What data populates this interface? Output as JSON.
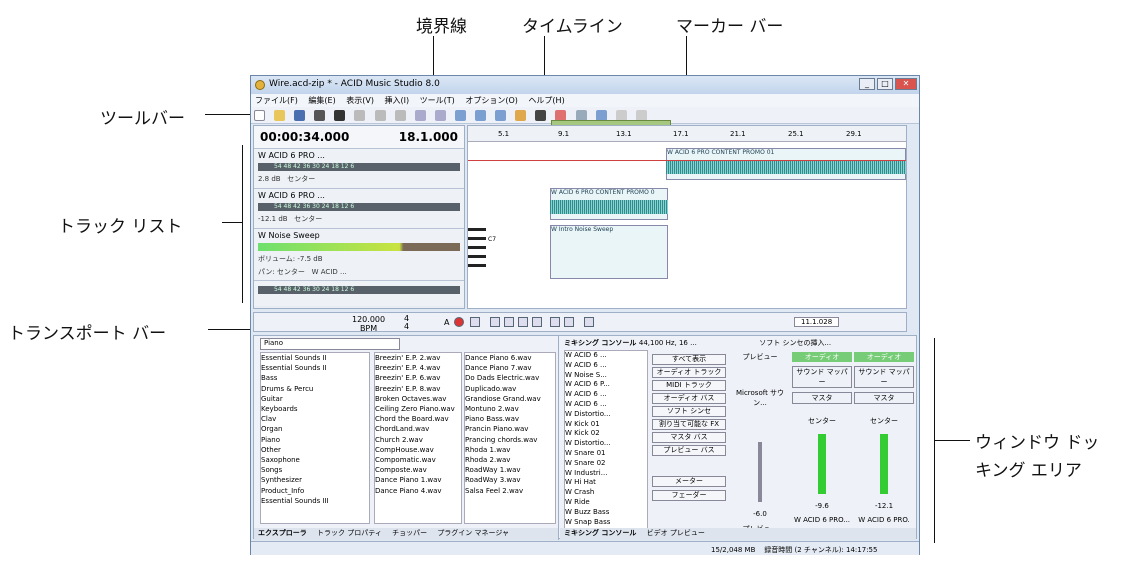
{
  "callouts": {
    "boundary": "境界線",
    "timeline": "タイムライン",
    "marker_bar": "マーカー バー",
    "toolbar": "ツールバー",
    "track_list": "トラック リスト",
    "transport_bar": "トランスポート バー",
    "docking_area_1": "ウィンドウ ドッ",
    "docking_area_2": "キング エリア"
  },
  "window": {
    "title": "Wire.acd-zip * - ACID Music Studio 8.0"
  },
  "menu": [
    "ファイル(F)",
    "編集(E)",
    "表示(V)",
    "挿入(I)",
    "ツール(T)",
    "オプション(O)",
    "ヘルプ(H)"
  ],
  "time": {
    "position": "00:00:34.000",
    "beat": "18.1.000"
  },
  "tracks": [
    {
      "name": "W ACID 6 PRO ...",
      "out": "アウト",
      "db": "2.8 dB",
      "pan": "センター",
      "meter": "54 48 42 36 30 24 18 12 6"
    },
    {
      "name": "W ACID 6 PRO ...",
      "out": "アウト",
      "db": "-12.1 dB",
      "pan": "センター",
      "meter": "54 48 42 36 30 24 18 12 6"
    },
    {
      "name": "W Noise Sweep",
      "out": "アウト",
      "db": "ボリューム: -7.5 dB",
      "pan": "パン: センター",
      "bus": "W ACID ..."
    },
    {
      "name": "",
      "out": "アウト",
      "db": "",
      "pan": "",
      "meter": "54 48 42 36 30 24 18 12 6"
    }
  ],
  "ruler": [
    "5.1",
    "9.1",
    "13.1",
    "17.1",
    "21.1",
    "25.1",
    "29.1"
  ],
  "clips": {
    "a": "W ACID 6 PRO CONTENT PROMO 01",
    "b": "W ACID 6 PRO CONTENT PROMO 0",
    "c": "W Intro Noise Sweep",
    "note": "C7"
  },
  "transport": {
    "tempo": "120.000",
    "bpm": "BPM",
    "sig_top": "4",
    "sig_bottom": "4",
    "key": "A",
    "position": "11.1.028"
  },
  "explorer": {
    "path": "Piano",
    "tree": [
      "Essential Sounds II",
      "Essential Sounds II",
      "Bass",
      "Drums & Percu",
      "Guitar",
      "Keyboards",
      "Clav",
      "Organ",
      "Piano",
      "Other",
      "Saxophone",
      "Songs",
      "Synthesizer",
      "Product_Info",
      "Essential Sounds III"
    ],
    "files1": [
      "Breezin' E.P. 2.wav",
      "Breezin' E.P. 4.wav",
      "Breezin' E.P. 6.wav",
      "Breezin' E.P. 8.wav",
      "Broken Octaves.wav",
      "Ceiling Zero Piano.wav",
      "Chord the Board.wav",
      "ChordLand.wav",
      "Church 2.wav",
      "CompHouse.wav",
      "Compomatic.wav",
      "Composte.wav",
      "Dance Piano 1.wav",
      "Dance Piano 4.wav"
    ],
    "files2": [
      "Dance Piano 6.wav",
      "Dance Piano 7.wav",
      "Do Dads Electric.wav",
      "Duplicado.wav",
      "Grandiose Grand.wav",
      "Montuno 2.wav",
      "Piano Bass.wav",
      "Prancin Piano.wav",
      "Prancing chords.wav",
      "Rhoda 1.wav",
      "Rhoda 2.wav",
      "RoadWay 1.wav",
      "RoadWay 3.wav",
      "Salsa Feel 2.wav"
    ],
    "tabs": [
      "エクスプローラ",
      "トラック プロパティ",
      "チョッパー",
      "プラグイン マネージャ"
    ]
  },
  "mixer": {
    "title": "ミキシング コンソール",
    "rate": "44,100 Hz, 16 ...",
    "softsynth": "ソフト シンセの挿入...",
    "list": [
      "W ACID 6 ...",
      "W ACID 6 ...",
      "W Noise S...",
      "W ACID 6 P...",
      "W ACID 6 ...",
      "W ACID 6 ...",
      "W Distortio...",
      "W Kick 01",
      "W Kick 02",
      "W Distortio...",
      "W Snare 01",
      "W Snare 02",
      "W Industri...",
      "W Hi Hat",
      "W Crash",
      "W Ride",
      "W Buzz Bass",
      "W Snap Bass"
    ],
    "buttons": [
      "すべて表示",
      "オーディオ トラック",
      "MIDI トラック",
      "オーディオ バス",
      "ソフト シンセ",
      "割り当て可能な FX",
      "マスタ バス",
      "プレビュー バス",
      "メーター",
      "フェーダー"
    ],
    "strips": [
      {
        "head": "プレビュー",
        "device": "Microsoft サウン...",
        "value": "-6.0",
        "name": "プレビュー"
      },
      {
        "head": "オーディオ",
        "device": "サウンド マッパー",
        "bus": "マスタ",
        "pan": "センター",
        "value": "-9.6",
        "name": "W ACID 6 PRO..."
      },
      {
        "head": "オーディオ",
        "device": "サウンド マッパー",
        "bus": "マスタ",
        "pan": "センター",
        "value": "-12.1",
        "name": "W ACID 6 PRO."
      }
    ],
    "tabs": [
      "ミキシング コンソール",
      "ビデオ プレビュー"
    ]
  },
  "status": {
    "memory": "15/2,048 MB",
    "record": "録音時間 (2 チャンネル): 14:17:55"
  }
}
